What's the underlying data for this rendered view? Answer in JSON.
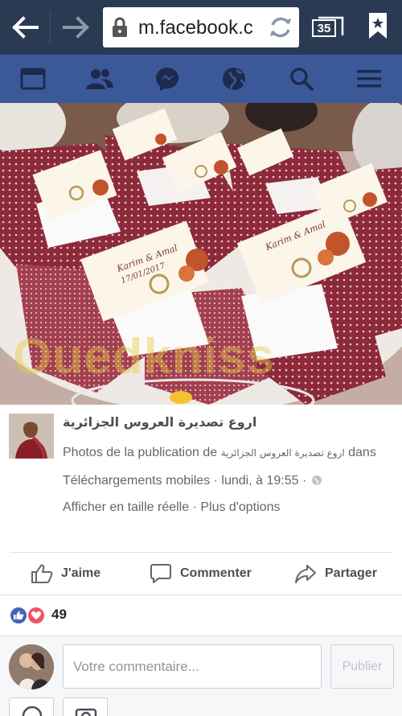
{
  "browser": {
    "url": "m.facebook.c",
    "tab_count": "35",
    "icons": [
      "back-icon",
      "forward-icon",
      "lock-icon",
      "reload-icon",
      "tabs-icon",
      "bookmark-icon"
    ]
  },
  "fb_nav": {
    "icons": [
      "news-feed-icon",
      "friends-icon",
      "messenger-icon",
      "notifications-globe-icon",
      "search-icon",
      "menu-icon"
    ]
  },
  "photo": {
    "watermark": "Ouedkniss",
    "card_text": [
      "Karim & Amal",
      "17/01/2017"
    ]
  },
  "post": {
    "page_name": "اروع تصديرة العروس الجزائرية",
    "line1_prefix": "Photos de la publication de ",
    "line1_page": "اروع تصديرة العروس الجزائرية",
    "line1_suffix": " dans",
    "line2": "Téléchargements mobiles · lundi, à 19:55 ·",
    "link_full_size": "Afficher en taille réelle",
    "link_sep": " · ",
    "link_more": "Plus d'options"
  },
  "actions": {
    "like": "J'aime",
    "comment": "Commenter",
    "share": "Partager"
  },
  "reactions": {
    "count": "49",
    "types": [
      "like",
      "love"
    ]
  },
  "composer": {
    "placeholder": "Votre commentaire...",
    "publish": "Publier"
  },
  "colors": {
    "browser_bar": "#2a3a52",
    "facebook_blue": "#3b5998",
    "like_blue": "#4267b2",
    "love_red": "#f25268"
  }
}
